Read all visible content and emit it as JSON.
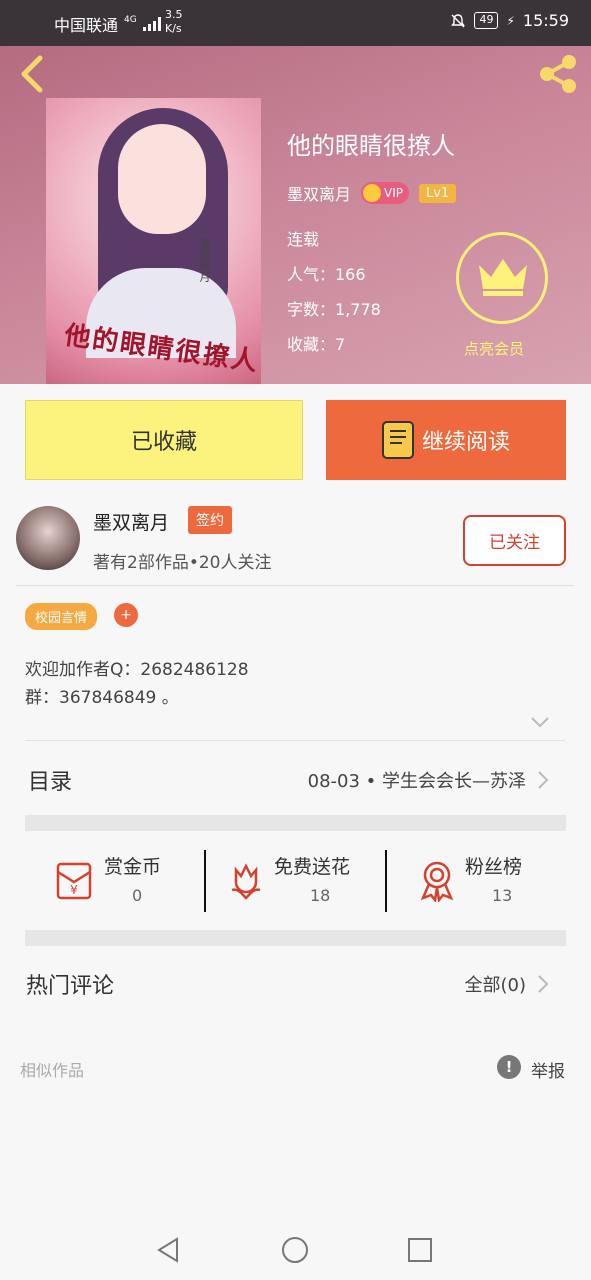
{
  "status_bar": {
    "carrier": "中国联通",
    "network": "4G",
    "speed_value": "3.5",
    "speed_unit": "K/s",
    "battery": "49",
    "time": "15:59"
  },
  "book": {
    "title": "他的眼睛很撩人",
    "author": "墨双离月",
    "vip_label": "VIP",
    "level": "Lv1",
    "status": "连载",
    "popularity": "人气：166",
    "word_count": "字数：1,778",
    "favorites": "收藏：7",
    "cover_title": "他的眼睛很撩人",
    "cover_author": "墨双离月"
  },
  "member": {
    "label": "点亮会员"
  },
  "actions": {
    "collected_label": "已收藏",
    "read_label": "继续阅读"
  },
  "author_section": {
    "name": "墨双离月",
    "signed_badge": "签约",
    "stats": "著有2部作品•20人关注",
    "follow_label": "已关注"
  },
  "tags": {
    "genre": "校园言情",
    "add": "+"
  },
  "intro": {
    "text": "欢迎加作者Q：2682486128\n群：367846849 。"
  },
  "toc": {
    "label": "目录",
    "latest": "08-03 • 学生会会长—苏泽"
  },
  "stats": {
    "coins": {
      "label": "赏金币",
      "value": "0"
    },
    "flowers": {
      "label": "免费送花",
      "value": "18"
    },
    "fans": {
      "label": "粉丝榜",
      "value": "13"
    }
  },
  "comments": {
    "label": "热门评论",
    "all_label": "全部(0)"
  },
  "footer": {
    "similar_label": "相似作品",
    "report_label": "举报",
    "report_icon": "!"
  },
  "colors": {
    "accent_orange": "#ee6a3e",
    "collected_yellow": "#fbf37e",
    "follow_red": "#d4412f",
    "member_yellow": "#fff27a"
  }
}
